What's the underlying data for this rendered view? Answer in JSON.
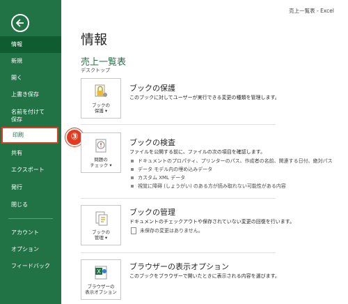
{
  "window_title": "売上一覧表 - Excel",
  "sidebar": {
    "items": [
      {
        "label": "情報"
      },
      {
        "label": "新規"
      },
      {
        "label": "開く"
      },
      {
        "label": "上書き保存"
      },
      {
        "label": "名前を付けて\n保存"
      },
      {
        "label": "印刷"
      },
      {
        "label": "共有"
      },
      {
        "label": "エクスポート"
      },
      {
        "label": "発行"
      },
      {
        "label": "閉じる"
      },
      {
        "label": "アカウント"
      },
      {
        "label": "オプション"
      },
      {
        "label": "フィードバック"
      }
    ]
  },
  "page": {
    "title": "情報",
    "doc_title": "売上一覧表",
    "doc_path": "デスクトップ"
  },
  "step_badge": "③",
  "sections": {
    "protect": {
      "button_label": "ブックの\n保護 ▾",
      "title": "ブックの保護",
      "desc": "このブックに対してユーザーが実行できる変更の種類を管理します。"
    },
    "inspect": {
      "button_label": "問題の\nチェック ▾",
      "title": "ブックの検査",
      "desc": "ファイルを公開する前に、ファイルの次の項目を確認します。",
      "bullets": [
        "ドキュメントのプロパティ、プリンターのパス、作成者の名前、関連する日付、絶対パス",
        "データ モデル内の埋め込みデータ",
        "カスタム XML データ",
        "視覚に障碍 (しょうがい) のある方が読み取れない可能性がある内容"
      ]
    },
    "manage": {
      "button_label": "ブックの\n管理 ▾",
      "title": "ブックの管理",
      "desc": "ドキュメントのチェックアウトや保存されていない変更の回復を行います。",
      "info": "未保存の変更はありません。"
    },
    "browser": {
      "button_label": "ブラウザーの\n表示オプション",
      "title": "ブラウザーの表示オプション",
      "desc": "このブックをブラウザーで開いたときに表示される内容を選びます。"
    }
  },
  "colors": {
    "accent": "#217346",
    "sidebar_selected": "#0e5c2f",
    "highlight_red": "#e23a1f"
  }
}
